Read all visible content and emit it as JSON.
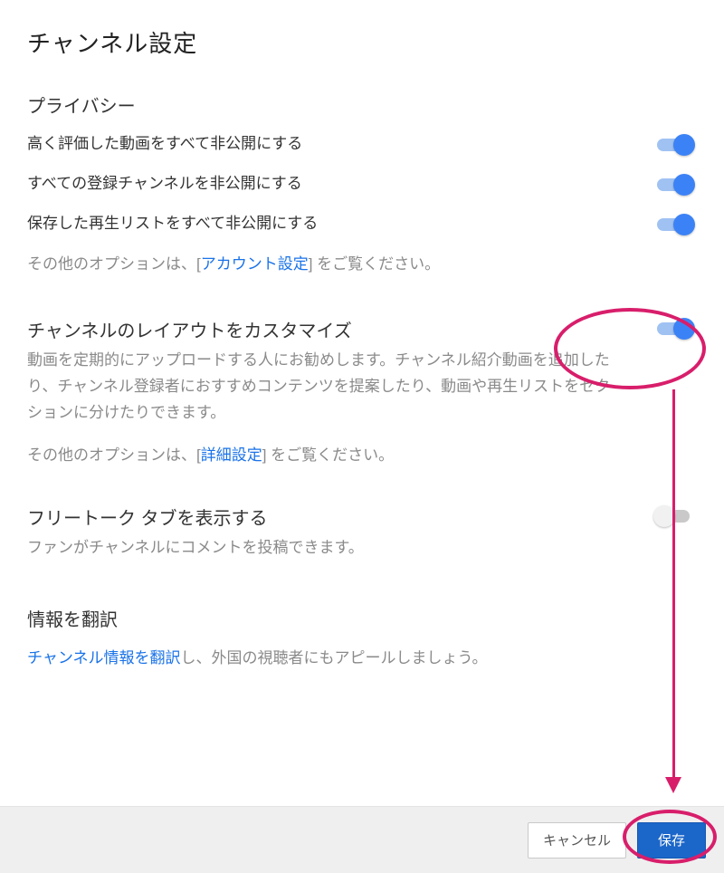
{
  "page_title": "チャンネル設定",
  "privacy": {
    "heading": "プライバシー",
    "rows": [
      {
        "label": "高く評価した動画をすべて非公開にする",
        "on": true
      },
      {
        "label": "すべての登録チャンネルを非公開にする",
        "on": true
      },
      {
        "label": "保存した再生リストをすべて非公開にする",
        "on": true
      }
    ],
    "hint_prefix": "その他のオプションは、[",
    "hint_link": "アカウント設定",
    "hint_suffix": "] をご覧ください。"
  },
  "layout": {
    "heading": "チャンネルのレイアウトをカスタマイズ",
    "on": true,
    "desc": "動画を定期的にアップロードする人にお勧めします。チャンネル紹介動画を追加したり、チャンネル登録者におすすめコンテンツを提案したり、動画や再生リストをセクションに分けたりできます。",
    "hint_prefix": "その他のオプションは、[",
    "hint_link": "詳細設定",
    "hint_suffix": "] をご覧ください。"
  },
  "freetalk": {
    "heading": "フリートーク タブを表示する",
    "on": false,
    "desc": "ファンがチャンネルにコメントを投稿できます。"
  },
  "translate": {
    "heading": "情報を翻訳",
    "link": "チャンネル情報を翻訳",
    "rest": "し、外国の視聴者にもアピールしましょう。"
  },
  "footer": {
    "cancel": "キャンセル",
    "save": "保存"
  }
}
